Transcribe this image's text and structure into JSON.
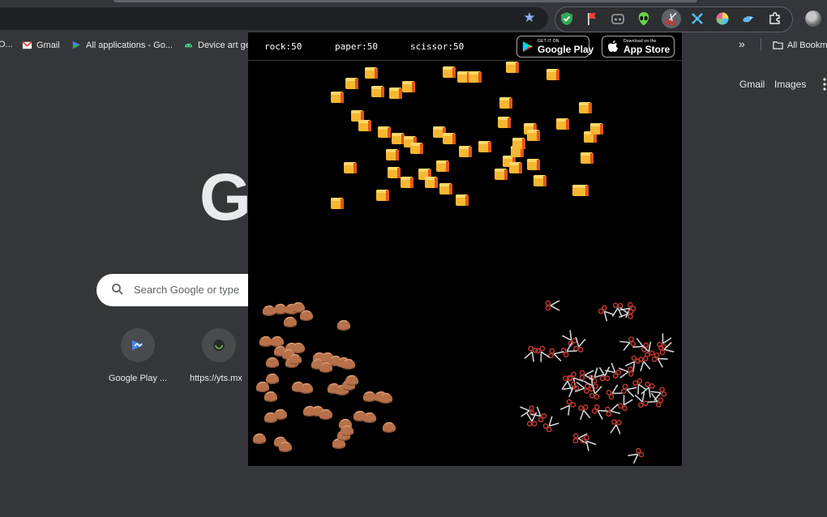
{
  "browser": {
    "bookmarks": [
      {
        "label": "O...",
        "icon": "doc-icon"
      },
      {
        "label": "Gmail",
        "icon": "gmail-icon"
      },
      {
        "label": "All applications - Go...",
        "icon": "play-console-icon"
      },
      {
        "label": "Device art ge...",
        "icon": "android-icon"
      }
    ],
    "bookmarks_more": "»",
    "all_bookmarks": "All Bookm",
    "extensions": [
      "shield-check-icon",
      "red-flag-icon",
      "controller-icon",
      "alien-icon",
      "scissors-icon",
      "puzzle-blue-icon",
      "color-wheel-icon",
      "bird-icon",
      "extensions-puzzle-icon"
    ]
  },
  "newtab": {
    "logo_visible_letter": "G",
    "search_placeholder": "Search Google or type",
    "top_links": [
      "Gmail",
      "Images"
    ],
    "shortcuts": [
      {
        "label": "Google Play ...",
        "icon": "google-play-console-icon"
      },
      {
        "label": "https://yts.mx",
        "icon": "yts-icon"
      }
    ]
  },
  "game": {
    "scores": [
      {
        "name": "rock",
        "value": 50,
        "text": "rock:50"
      },
      {
        "name": "paper",
        "value": 50,
        "text": "paper:50"
      },
      {
        "name": "scissor",
        "value": 50,
        "text": "scissor:50"
      }
    ],
    "google_play": {
      "small": "GET IT ON",
      "big": "Google Play"
    },
    "app_store": {
      "small": "Download on the",
      "big": "App Store"
    },
    "piece_counts": {
      "rock": 50,
      "paper": 50,
      "scissor": 50
    },
    "colors": {
      "background": "#000000",
      "paper": "#f7b731",
      "rock": "#b7714a",
      "scissor_handle": "#c0392b",
      "scissor_blade": "#cfd2d6"
    }
  }
}
